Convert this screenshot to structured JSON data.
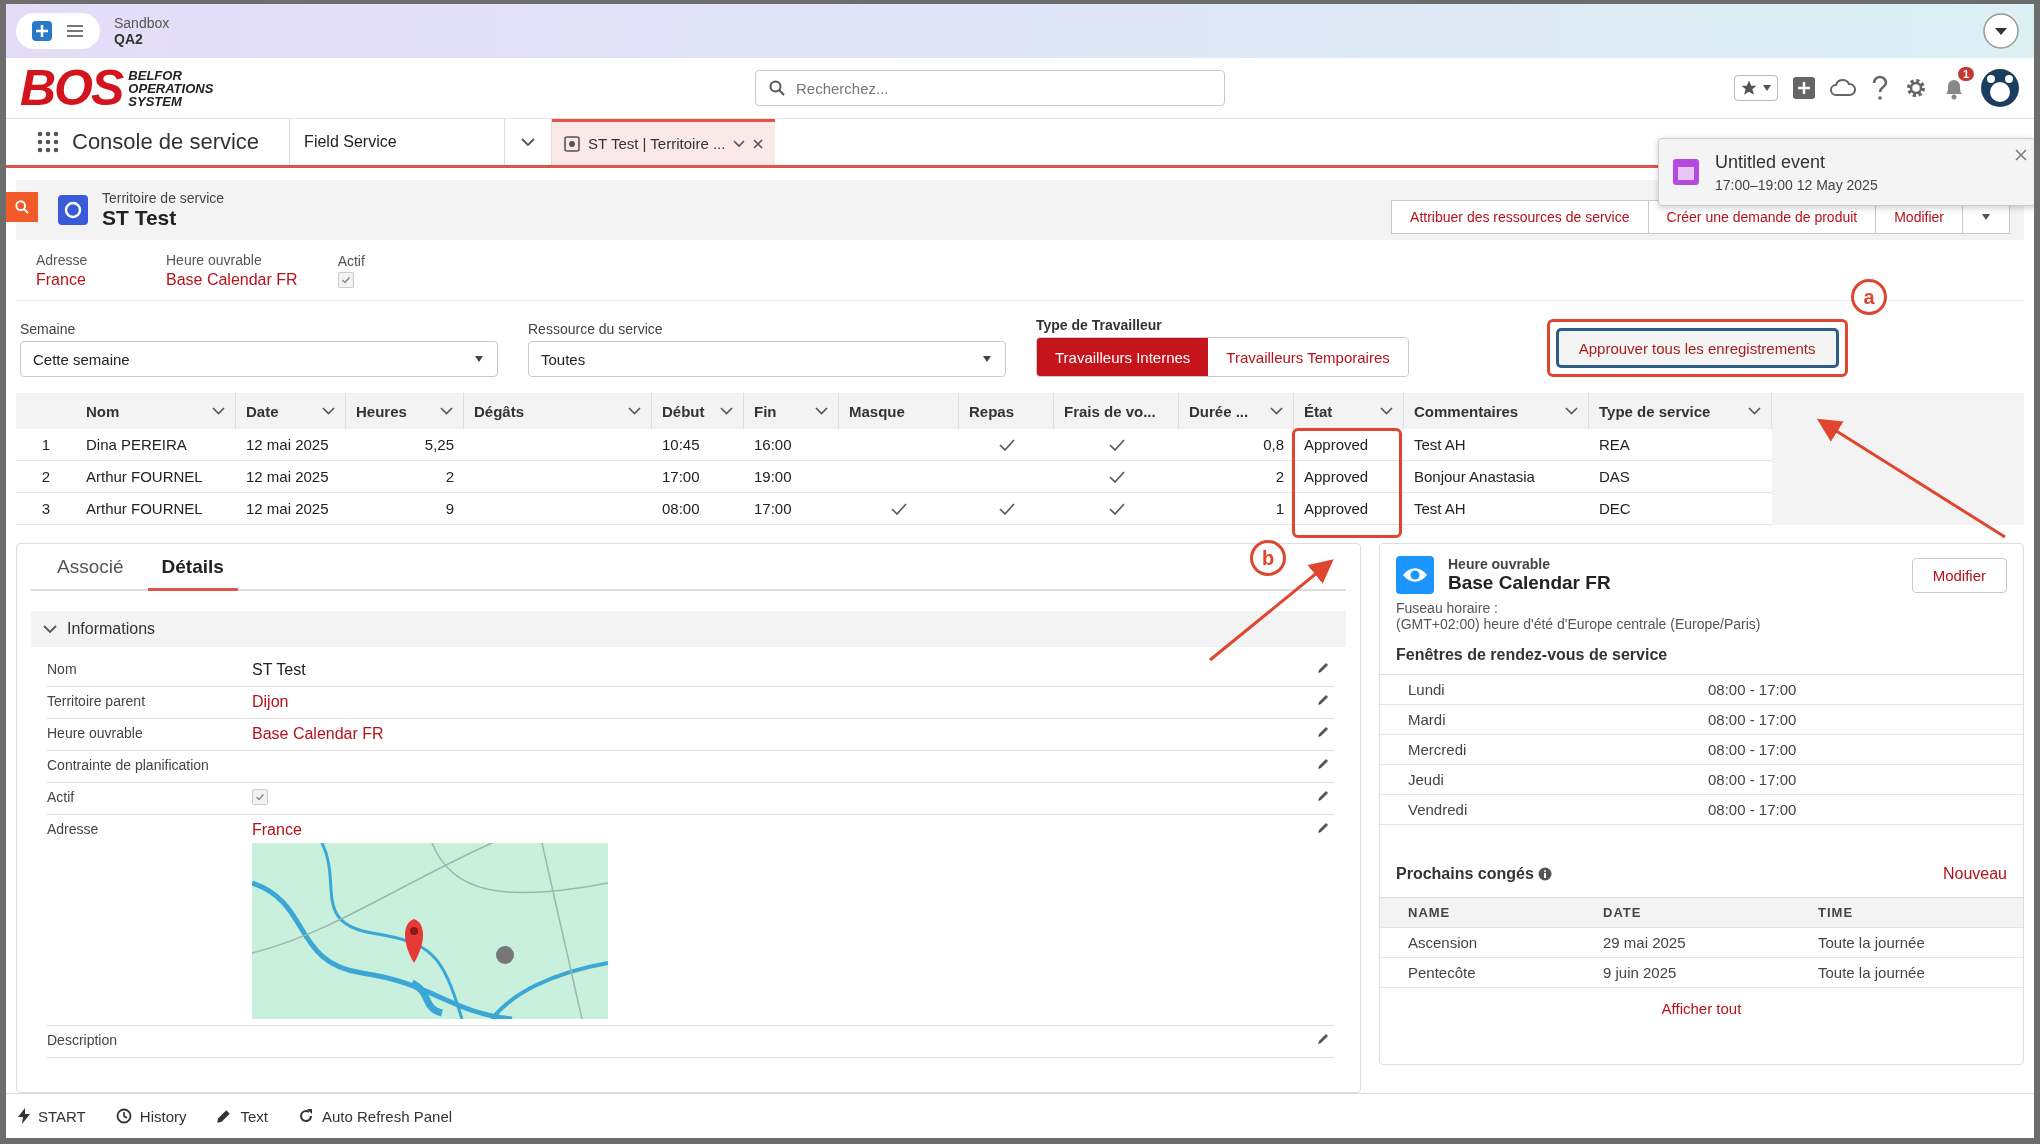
{
  "top_bar": {
    "environment": "Sandbox",
    "org": "QA2"
  },
  "header": {
    "logo": "BOS",
    "logo_subtitle": [
      "BELFOR",
      "OPERATIONS",
      "SYSTEM"
    ],
    "search": {
      "placeholder": "Recherchez..."
    },
    "notification_count": "1"
  },
  "nav": {
    "app_name": "Console de service",
    "object_menu": "Field Service",
    "tabs": [
      {
        "label": "ST Test | Territoire ...",
        "selected": true
      }
    ]
  },
  "toast": {
    "title": "Untitled event",
    "time": "17:00–19:00 12 May 2025"
  },
  "record": {
    "object_type": "Territoire de service",
    "name": "ST Test",
    "actions": [
      "Attribuer des ressources de service",
      "Créer une demande de produit",
      "Modifier"
    ],
    "fields": [
      {
        "label": "Adresse",
        "kind": "link",
        "value": "France"
      },
      {
        "label": "Heure ouvrable",
        "kind": "link",
        "value": "Base Calendar FR"
      },
      {
        "label": "Actif",
        "kind": "checkbox",
        "checked": true
      }
    ]
  },
  "filters": {
    "week": {
      "label": "Semaine",
      "value": "Cette semaine"
    },
    "resource": {
      "label": "Ressource du service",
      "value": "Toutes"
    },
    "worker_type": {
      "label": "Type de Travailleur",
      "options": [
        {
          "label": "Travailleurs Internes",
          "selected": true
        },
        {
          "label": "Travailleurs Temporaires",
          "selected": false
        }
      ]
    },
    "approve_button": "Approuver tous les enregistrements"
  },
  "table": {
    "columns": [
      {
        "label": "Nom",
        "kind": "text",
        "menu": true
      },
      {
        "label": "Date",
        "kind": "text",
        "menu": true
      },
      {
        "label": "Heures",
        "kind": "number",
        "menu": true
      },
      {
        "label": "Dégâts",
        "kind": "text",
        "menu": true
      },
      {
        "label": "Début",
        "kind": "text",
        "menu": true
      },
      {
        "label": "Fin",
        "kind": "text",
        "menu": true
      },
      {
        "label": "Masque",
        "kind": "check",
        "menu": false
      },
      {
        "label": "Repas",
        "kind": "check",
        "menu": false
      },
      {
        "label": "Frais de vo...",
        "kind": "check",
        "menu": false
      },
      {
        "label": "Durée ...",
        "kind": "number",
        "menu": true
      },
      {
        "label": "État",
        "kind": "text",
        "menu": true
      },
      {
        "label": "Commentaires",
        "kind": "text",
        "menu": true
      },
      {
        "label": "Type de service",
        "kind": "text",
        "menu": true
      }
    ],
    "rows": [
      {
        "index": "1",
        "cells": [
          "Dina PEREIRA",
          "12 mai 2025",
          "5,25",
          null,
          "10:45",
          "16:00",
          false,
          true,
          true,
          "0,8",
          "Approved",
          "Test AH",
          "REA"
        ]
      },
      {
        "index": "2",
        "cells": [
          "Arthur FOURNEL",
          "12 mai 2025",
          "2",
          null,
          "17:00",
          "19:00",
          false,
          false,
          true,
          "2",
          "Approved",
          "Bonjour Anastasia",
          "DAS"
        ]
      },
      {
        "index": "3",
        "cells": [
          "Arthur FOURNEL",
          "12 mai 2025",
          "9",
          null,
          "08:00",
          "17:00",
          true,
          true,
          true,
          "1",
          "Approved",
          "Test AH",
          "DEC"
        ]
      }
    ]
  },
  "annotations": [
    {
      "label": "a"
    },
    {
      "label": "b"
    }
  ],
  "details": {
    "tabs": [
      {
        "label": "Associé",
        "selected": false
      },
      {
        "label": "Détails",
        "selected": true
      }
    ],
    "section": {
      "title": "Informations",
      "expanded": true
    },
    "fields": [
      {
        "label": "Nom",
        "kind": "text",
        "value": "ST Test"
      },
      {
        "label": "Territoire parent",
        "kind": "link",
        "value": "Dijon"
      },
      {
        "label": "Heure ouvrable",
        "kind": "link",
        "value": "Base Calendar FR"
      },
      {
        "label": "Contrainte de planification",
        "kind": "empty"
      },
      {
        "label": "Actif",
        "kind": "checkbox",
        "checked": true
      },
      {
        "label": "Adresse",
        "kind": "address",
        "value": "France"
      },
      {
        "label": "Description",
        "kind": "empty"
      }
    ]
  },
  "hours_card": {
    "object_type": "Heure ouvrable",
    "name": "Base Calendar FR",
    "edit_button": "Modifier",
    "timezone_label": "Fuseau horaire :",
    "timezone": "(GMT+02:00) heure d'été d'Europe centrale (Europe/Paris)",
    "windows_title": "Fenêtres de rendez-vous de service",
    "windows": [
      {
        "day": "Lundi",
        "hours": "08:00 - 17:00"
      },
      {
        "day": "Mardi",
        "hours": "08:00 - 17:00"
      },
      {
        "day": "Mercredi",
        "hours": "08:00 - 17:00"
      },
      {
        "day": "Jeudi",
        "hours": "08:00 - 17:00"
      },
      {
        "day": "Vendredi",
        "hours": "08:00 - 17:00"
      }
    ],
    "holidays": {
      "title": "Prochains congés",
      "new_link": "Nouveau",
      "columns": [
        "NAME",
        "DATE",
        "TIME"
      ],
      "rows": [
        [
          "Ascension",
          "29 mai 2025",
          "Toute la journée"
        ],
        [
          "Pentecôte",
          "9 juin 2025",
          "Toute la journée"
        ]
      ],
      "view_all": "Afficher tout"
    }
  },
  "footer": [
    {
      "label": "START",
      "kind": "bolt"
    },
    {
      "label": "History",
      "kind": "clock"
    },
    {
      "label": "Text",
      "kind": "pencil"
    },
    {
      "label": "Auto Refresh Panel",
      "kind": "refresh"
    }
  ]
}
